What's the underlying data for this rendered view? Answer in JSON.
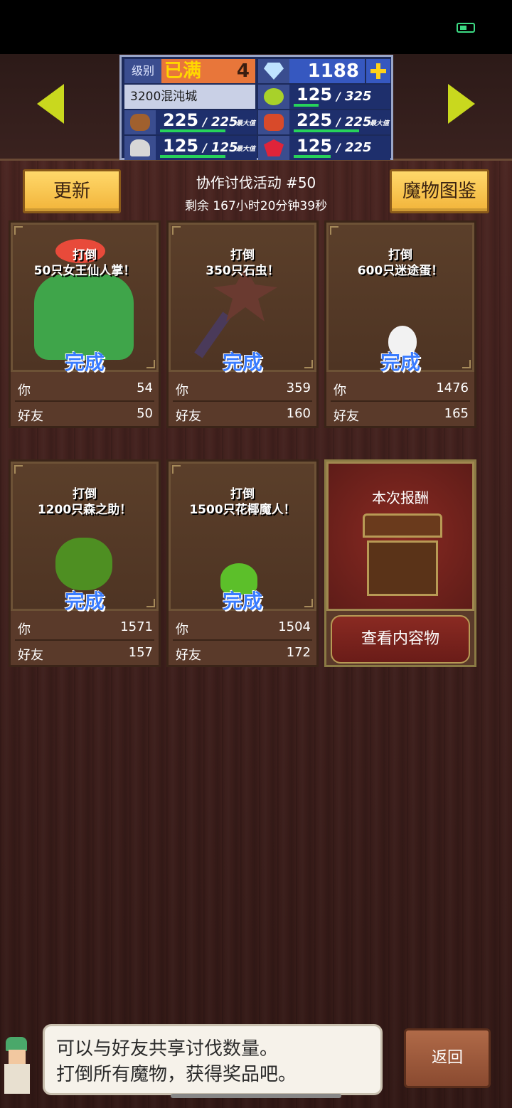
{
  "stats": {
    "level_label": "级别",
    "level_max": "已满",
    "level_value": "4",
    "gems": "1188",
    "city": "3200混沌城",
    "resources": [
      {
        "name": "wood",
        "value": "225",
        "cap": "225",
        "fill": 1.0,
        "max_label": "最大值",
        "icon": "wood-icon"
      },
      {
        "name": "grass",
        "value": "125",
        "cap": "325",
        "fill": 0.38,
        "max_label": "",
        "icon": "grass-icon"
      },
      {
        "name": "food",
        "value": "225",
        "cap": "225",
        "fill": 1.0,
        "max_label": "最大值",
        "icon": "food-icon"
      },
      {
        "name": "stone",
        "value": "125",
        "cap": "125",
        "fill": 1.0,
        "max_label": "最大值",
        "icon": "stone-icon"
      },
      {
        "name": "ruby",
        "value": "125",
        "cap": "225",
        "fill": 0.56,
        "max_label": "",
        "icon": "ruby-icon"
      }
    ]
  },
  "header": {
    "update_label": "更新",
    "event_title": "协作讨伐活动 #50",
    "timer": "剩余 167小时20分钟39秒",
    "dex_label": "魔物图鉴"
  },
  "cards": [
    {
      "defeat": "打倒",
      "target": "50只女王仙人掌！",
      "status": "完成",
      "you_label": "你",
      "you": "54",
      "friend_label": "好友",
      "friend": "50"
    },
    {
      "defeat": "打倒",
      "target": "350只石虫！",
      "status": "完成",
      "you_label": "你",
      "you": "359",
      "friend_label": "好友",
      "friend": "160"
    },
    {
      "defeat": "打倒",
      "target": "600只迷途蛋！",
      "status": "完成",
      "you_label": "你",
      "you": "1476",
      "friend_label": "好友",
      "friend": "165"
    },
    {
      "defeat": "打倒",
      "target": "1200只森之助！",
      "status": "完成",
      "you_label": "你",
      "you": "1571",
      "friend_label": "好友",
      "friend": "157"
    },
    {
      "defeat": "打倒",
      "target": "1500只花椰魔人！",
      "status": "完成",
      "you_label": "你",
      "you": "1504",
      "friend_label": "好友",
      "friend": "172"
    }
  ],
  "reward": {
    "title": "本次报酬",
    "button": "查看内容物"
  },
  "dialog": {
    "line1": "可以与好友共享讨伐数量。",
    "line2": "打倒所有魔物，获得奖品吧。"
  },
  "back_label": "返回",
  "colors": {
    "accent_gold": "#f2b43a",
    "done_blue": "#3a7cff",
    "bar_green": "#27d35a"
  }
}
